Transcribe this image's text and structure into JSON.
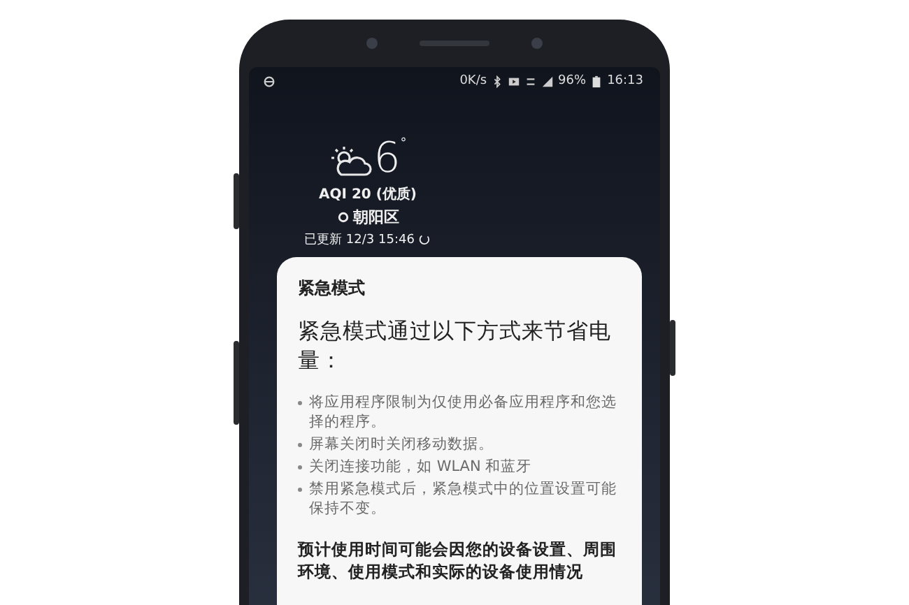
{
  "status_bar": {
    "speed": "0K/s",
    "battery": "96%",
    "time": "16:13"
  },
  "weather": {
    "temperature": "6",
    "degree": "°",
    "aqi": "AQI 20 (优质)",
    "location": "朝阳区",
    "updated": "已更新 12/3 15:46"
  },
  "dialog": {
    "title": "紧急模式",
    "heading": "紧急模式通过以下方式来节省电量：",
    "bullets": [
      "将应用程序限制为仅使用必备应用程序和您选择的程序。",
      "屏幕关闭时关闭移动数据。",
      "关闭连接功能，如 WLAN 和蓝牙",
      "禁用紧急模式后，紧急模式中的位置设置可能保持不变。"
    ],
    "note": "预计使用时间可能会因您的设备设置、周围环境、使用模式和实际的设备使用情况"
  }
}
